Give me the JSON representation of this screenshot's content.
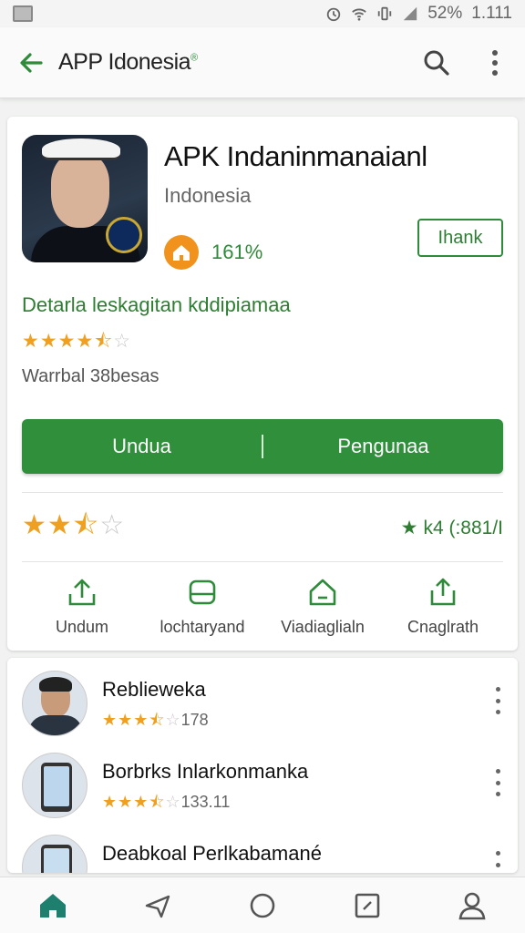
{
  "status_bar": {
    "battery": "52%",
    "time": "1.111"
  },
  "app_bar": {
    "title": "APP Idonesia",
    "title_mark": "®"
  },
  "app": {
    "name": "APK Indaninmanaianl",
    "developer": "Indonesia",
    "rank_percent": "161%",
    "rank_button": "Ihank",
    "description_title": "Detarla leskagitan kddipiamaa",
    "rating_stars": "★★★★☆",
    "review_count": "Warrbal 38besas",
    "button_left": "Undua",
    "button_right": "Pengunaa",
    "rating_count": "k4 (:881/I"
  },
  "actions": [
    {
      "label": "Undum",
      "icon": "upload-icon"
    },
    {
      "label": "lochtaryand",
      "icon": "device-icon"
    },
    {
      "label": "Viadiaglialn",
      "icon": "home-share-icon"
    },
    {
      "label": "Cnaglrath",
      "icon": "share-icon"
    }
  ],
  "list": [
    {
      "name": "Reblieweka",
      "rating": "178"
    },
    {
      "name": "Borbrks Inlarkonmanka",
      "rating": "133.11"
    },
    {
      "name": "Deabkoal Perlkabamané",
      "rating": ""
    }
  ],
  "colors": {
    "accent": "#2f8f3a",
    "star": "#f0a020",
    "badge": "#f0921c"
  }
}
